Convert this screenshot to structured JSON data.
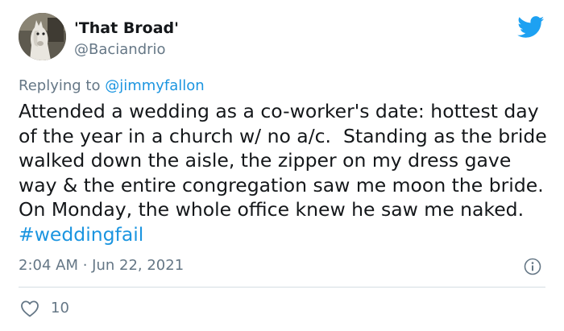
{
  "author": {
    "display_name": "'That Broad'",
    "handle": "@Baciandrio",
    "avatar_icon": "horse-avatar"
  },
  "reply": {
    "prefix": "Replying to ",
    "mention": "@jimmyfallon"
  },
  "tweet": {
    "text": "Attended a wedding as a co-worker's date: hottest day of the year in a church w/ no a/c.  Standing as the bride walked down the aisle, the zipper on my dress gave way & the entire congregation saw me moon the bride.  On Monday, the whole office knew he saw me naked. ",
    "hashtag": "#weddingfail",
    "timestamp": "2:04 AM · Jun 22, 2021"
  },
  "engagement": {
    "like_count": "10"
  },
  "colors": {
    "link": "#1b95e0",
    "muted": "#657786",
    "text": "#14171a",
    "twitter_brand": "#1da1f2"
  },
  "icons": {
    "brand": "twitter-bird-icon",
    "info": "info-icon",
    "like": "heart-icon"
  }
}
